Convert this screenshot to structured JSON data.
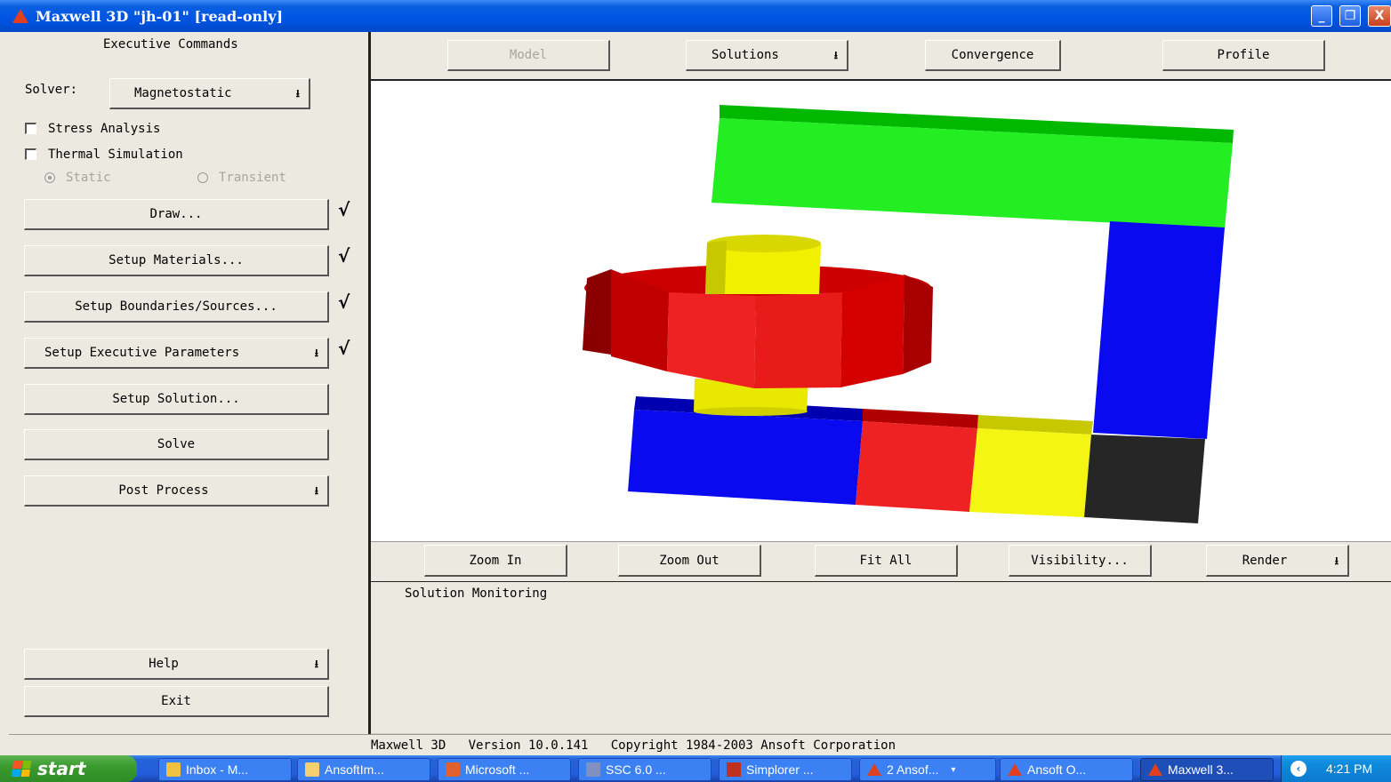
{
  "window": {
    "title": "Maxwell 3D \"jh-01\" [read-only]",
    "controls": {
      "minimize": "_",
      "restore": "❐",
      "close": "X"
    }
  },
  "left": {
    "header": "Executive Commands",
    "solver_label": "Solver:",
    "solver_value": "Magnetostatic",
    "stress_label": "Stress Analysis",
    "thermal_label": "Thermal Simulation",
    "static_label": "Static",
    "transient_label": "Transient",
    "check_mark": "√",
    "buttons": {
      "draw": "Draw...",
      "materials": "Setup Materials...",
      "boundaries": "Setup Boundaries/Sources...",
      "exec_params": "Setup Executive Parameters",
      "solution": "Setup Solution...",
      "solve": "Solve",
      "post": "Post Process",
      "help": "Help",
      "exit": "Exit"
    }
  },
  "top": {
    "model": "Model",
    "solutions": "Solutions",
    "convergence": "Convergence",
    "profile": "Profile"
  },
  "view": {
    "zoom_in": "Zoom In",
    "zoom_out": "Zoom Out",
    "fit_all": "Fit All",
    "visibility": "Visibility...",
    "render": "Render"
  },
  "monitor": {
    "title": "Solution Monitoring"
  },
  "status": {
    "text": "Maxwell 3D   Version 10.0.141   Copyright 1984-2003 Ansoft Corporation"
  },
  "taskbar": {
    "start": "start",
    "tasks": [
      "Inbox - M...",
      "AnsoftIm...",
      "Microsoft ...",
      "SSC 6.0 ...",
      "Simplorer ...",
      "2 Ansof...",
      "Ansoft O...",
      "Maxwell 3..."
    ],
    "clock": "4:21 PM"
  },
  "colors": {
    "green": "#00ee00",
    "blue": "#0000ff",
    "red": "#ee1111",
    "yellow": "#f0f000",
    "black": "#222222"
  }
}
